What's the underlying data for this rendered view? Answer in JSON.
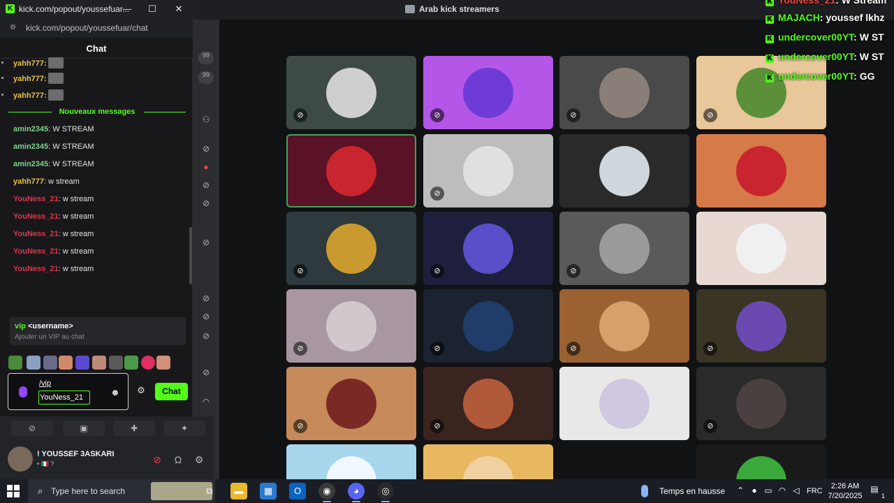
{
  "popout": {
    "tab_title": "kick.com/popout/youssefuar/chat",
    "tab_title_short": "kick.com/popout/youssefuar...",
    "url": "kick.com/popout/youssefuar/chat",
    "minimize": "—",
    "maximize": "☐",
    "close": "✕",
    "chat_title": "Chat"
  },
  "chat": {
    "top_messages": [
      {
        "user": "yahh777:",
        "text": ""
      },
      {
        "user": "yahh777:",
        "text": ""
      },
      {
        "user": "yahh777:",
        "text": ""
      }
    ],
    "new_messages_label": "Nouveaux messages",
    "messages": [
      {
        "user": "amin2345",
        "text": ": W STREAM",
        "color": "green"
      },
      {
        "user": "amin2345",
        "text": ": W STREAM",
        "color": "green"
      },
      {
        "user": "amin2345",
        "text": ": W STREAM",
        "color": "green"
      },
      {
        "user": "yahh777",
        "text": ": w stream",
        "color": "yellow"
      },
      {
        "user": "YouNess_21",
        "text": ": w stream",
        "color": "red"
      },
      {
        "user": "YouNess_21",
        "text": ": w stream",
        "color": "red"
      },
      {
        "user": "YouNess_21",
        "text": ": w stream",
        "color": "red"
      },
      {
        "user": "YouNess_21",
        "text": ": w stream",
        "color": "red"
      },
      {
        "user": "YouNess_21",
        "text": ": w stream",
        "color": "red"
      }
    ],
    "command_hint": {
      "keyword": "vip",
      "arg": "<username>",
      "description": "Ajouter un VIP au chat"
    },
    "input": {
      "command": "/vip",
      "username": "YouNess_21"
    },
    "send_label": "Chat"
  },
  "overlay": [
    {
      "user": "YouNess_21",
      "text": ": W Stream",
      "color": "red"
    },
    {
      "user": "MAJACH",
      "text": ": youssef lkhz",
      "color": "green"
    },
    {
      "user": "undercover00YT",
      "text": ": W ST",
      "color": "green"
    },
    {
      "user": "undercover00YT",
      "text": ": W ST",
      "color": "green"
    },
    {
      "user": "undercover00YT",
      "text": ": GG",
      "color": "green"
    }
  ],
  "discord": {
    "channel_title": "Arab kick streamers",
    "badge_count_1": "99",
    "badge_count_2": "99",
    "user_name": "! YOUSSEF 3ASKARI",
    "user_status": "• 🇮🇹 ?",
    "tiles": [
      {
        "bg": "#3d4a45",
        "avatar": "#cfcfcf",
        "muted": true
      },
      {
        "bg": "#b457e8",
        "avatar": "#6e3bd6",
        "muted": true
      },
      {
        "bg": "#4a4a4a",
        "avatar": "#8a7f78",
        "muted": true
      },
      {
        "bg": "#e8c89a",
        "avatar": "#5c8f3a",
        "muted": true
      },
      {
        "bg": "#5a1226",
        "avatar": "#c8252e",
        "muted": false,
        "speaking": true
      },
      {
        "bg": "#bdbdbd",
        "avatar": "#e0e0e0",
        "muted": true
      },
      {
        "bg": "#2a2a2a",
        "avatar": "#cfd6dc",
        "muted": false
      },
      {
        "bg": "#d67a4a",
        "avatar": "#c8252e",
        "muted": false
      },
      {
        "bg": "#2e3a3d",
        "avatar": "#c99a2f",
        "muted": true
      },
      {
        "bg": "#1d1f3d",
        "avatar": "#5a4fc8",
        "muted": true
      },
      {
        "bg": "#5a5a5a",
        "avatar": "#9a9a9a",
        "muted": true
      },
      {
        "bg": "#e8d8d2",
        "avatar": "#f0f0f0",
        "muted": false
      },
      {
        "bg": "#a897a0",
        "avatar": "#d0c8cc",
        "muted": true
      },
      {
        "bg": "#1b2330",
        "avatar": "#1f3c6a",
        "muted": true
      },
      {
        "bg": "#9a6232",
        "avatar": "#d6a06a",
        "muted": true
      },
      {
        "bg": "#3a3424",
        "avatar": "#6a4ab0",
        "muted": true
      },
      {
        "bg": "#c78a5a",
        "avatar": "#7a2a24",
        "muted": true
      },
      {
        "bg": "#3a2420",
        "avatar": "#b05a3a",
        "muted": true
      },
      {
        "bg": "#e8e8e8",
        "avatar": "#d0c8e0",
        "muted": false
      },
      {
        "bg": "#2a2a2a",
        "avatar": "#4a4040",
        "muted": true
      },
      {
        "bg": "#a8d6ec",
        "avatar": "#f0f8ff",
        "muted": false
      },
      {
        "bg": "#e8b860",
        "avatar": "#f0d0a0",
        "muted": false
      },
      {
        "bg": "#1a1a1a",
        "avatar": "#3aa83a",
        "muted": false
      }
    ]
  },
  "taskbar": {
    "search_placeholder": "Type here to search",
    "weather": "Temps en hausse",
    "language": "FRC",
    "time": "2:26 AM",
    "date": "7/20/2025",
    "notifications": "1"
  }
}
